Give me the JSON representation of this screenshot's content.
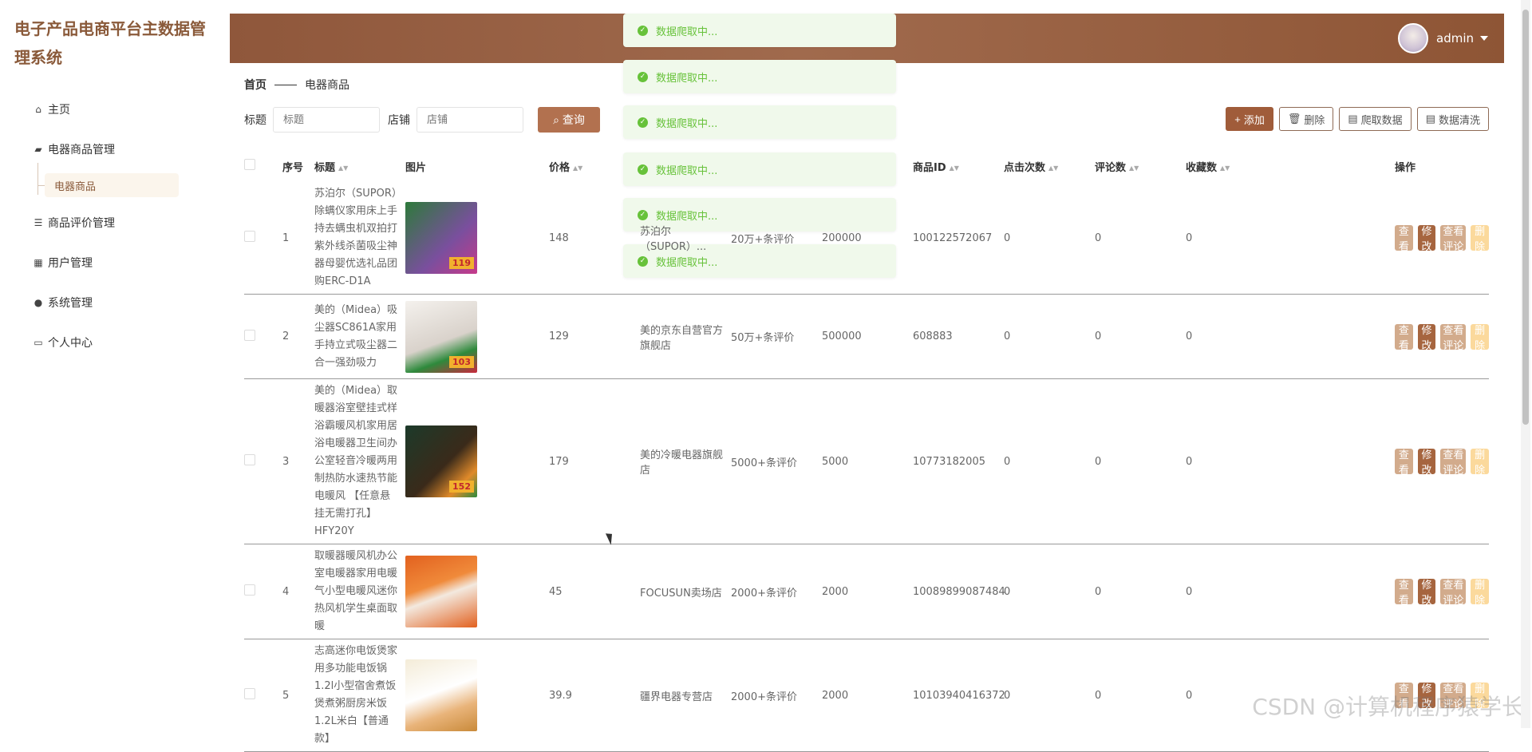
{
  "app": {
    "title": "电子产品电商平台主数据管理系统"
  },
  "sidebar": {
    "items": [
      {
        "label": "主页",
        "icon": "home-icon"
      },
      {
        "label": "电器商品管理",
        "icon": "box-icon"
      },
      {
        "label": "商品评价管理",
        "icon": "list-icon"
      },
      {
        "label": "用户管理",
        "icon": "grid-icon"
      },
      {
        "label": "系统管理",
        "icon": "shield-icon"
      },
      {
        "label": "个人中心",
        "icon": "card-icon"
      }
    ],
    "submenu": {
      "label": "电器商品"
    }
  },
  "header": {
    "user": "admin"
  },
  "toasts": [
    "数据爬取中...",
    "数据爬取中...",
    "数据爬取中...",
    "数据爬取中...",
    "数据爬取中...",
    "数据爬取中..."
  ],
  "breadcrumb": {
    "home": "首页",
    "current": "电器商品"
  },
  "filters": {
    "title_label": "标题",
    "title_placeholder": "标题",
    "shop_label": "店铺",
    "shop_placeholder": "店铺",
    "search_label": "查询"
  },
  "toolbar": {
    "add": "添加",
    "delete": "删除",
    "crawl": "爬取数据",
    "clean": "数据清洗"
  },
  "table": {
    "headers": [
      "序号",
      "标题",
      "图片",
      "价格",
      "",
      "",
      "",
      "商品ID",
      "点击次数",
      "评论数",
      "收藏数",
      "操作"
    ],
    "rows": [
      {
        "no": "1",
        "title": "苏泊尔（SUPOR）除螨仪家用床上手持去螨虫机双拍打紫外线杀菌吸尘神器母婴优选礼品团购ERC-D1A",
        "price": "148",
        "shop": "苏泊尔（SUPOR）...",
        "reviews_text": "20万+条评价",
        "count": "200000",
        "pid": "100122572067",
        "clicks": "0",
        "comments": "0",
        "favs": "0",
        "tag": "119"
      },
      {
        "no": "2",
        "title": "美的（Midea）吸尘器SC861A家用手持立式吸尘器二合一强劲吸力",
        "price": "129",
        "shop": "美的京东自营官方旗舰店",
        "reviews_text": "50万+条评价",
        "count": "500000",
        "pid": "608883",
        "clicks": "0",
        "comments": "0",
        "favs": "0",
        "tag": "103"
      },
      {
        "no": "3",
        "title": "美的（Midea）取暖器浴室壁挂式样浴霸暖风机家用居浴电暖器卫生间办公室轻音冷暖两用制热防水速热节能电暖风 【任意悬挂无需打孔】HFY20Y",
        "price": "179",
        "shop": "美的冷暖电器旗舰店",
        "reviews_text": "5000+条评价",
        "count": "5000",
        "pid": "10773182005",
        "clicks": "0",
        "comments": "0",
        "favs": "0",
        "tag": "152"
      },
      {
        "no": "4",
        "title": "取暖器暖风机办公室电暖器家用电暖气小型电暖风迷你热风机学生桌面取暖",
        "price": "45",
        "shop": "FOCUSUN卖场店",
        "reviews_text": "2000+条评价",
        "count": "2000",
        "pid": "10089899087484",
        "clicks": "0",
        "comments": "0",
        "favs": "0",
        "tag": ""
      },
      {
        "no": "5",
        "title": "志高迷你电饭煲家用多功能电饭锅1.2l小型宿舍煮饭煲煮粥厨房米饭 1.2L米白【普通款】",
        "price": "39.9",
        "shop": "疆界电器专营店",
        "reviews_text": "2000+条评价",
        "count": "2000",
        "pid": "10103940416372",
        "clicks": "0",
        "comments": "0",
        "favs": "0",
        "tag": ""
      }
    ],
    "ops": {
      "view": "查看",
      "edit": "修改",
      "comments": "查看评论",
      "delete": "删除"
    }
  },
  "watermark": "CSDN @计算机程序猿学长"
}
